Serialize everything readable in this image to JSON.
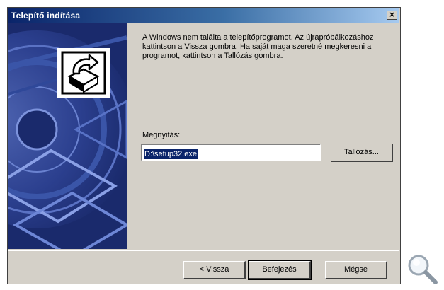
{
  "dialog": {
    "title": "Telepítő indítása",
    "close_glyph": "×",
    "message": "A Windows nem találta a telepítőprogramot. Az újrapróbálkozáshoz kattintson a Vissza gombra. Ha saját maga szeretné megkeresni a programot, kattintson a Tallózás gombra.",
    "open_label": "Megnyitás:",
    "open_value": "D:\\setup32.exe",
    "browse_label": "Tallózás...",
    "back_label": "< Vissza",
    "finish_label": "Befejezés",
    "cancel_label": "Mégse"
  },
  "icons": {
    "banner_art": "setup-wizard-cd-art",
    "install_icon": "install-program-icon",
    "zoom_icon": "magnifier-icon"
  },
  "colors": {
    "titlebar_start": "#0a246a",
    "titlebar_end": "#a6caf0",
    "dialog_face": "#d4d0c8",
    "banner_bg": "#1a2a6c",
    "selection_bg": "#0a246a"
  }
}
